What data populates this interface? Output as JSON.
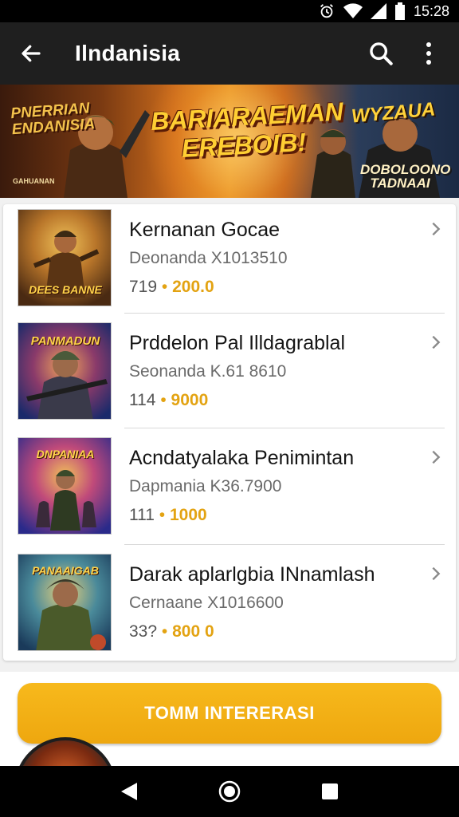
{
  "status_bar": {
    "time": "15:28",
    "icons": [
      "alarm-icon",
      "wifi-icon",
      "signal-icon",
      "battery-icon"
    ]
  },
  "app_bar": {
    "title": "Ilndanisia",
    "icons": [
      "back-arrow-icon",
      "search-icon",
      "overflow-menu-icon"
    ]
  },
  "banner": {
    "left_tag": "PNERRIAN ENDANISIA",
    "title": "BARIARAEMAN EREBOIB!",
    "right_tag": "WYZAUA",
    "right_sub": "DOBOLOONO TADNAAI",
    "corner_tag": "GAHUANAN"
  },
  "items": [
    {
      "title": "Kernanan Gocae",
      "subtitle": "Deonanda X1013510",
      "count": "719",
      "separator": "•",
      "price": "200.0",
      "thumb_label": "DEES BANNE"
    },
    {
      "title": "Prddelon  Pal Illdagrablal",
      "subtitle": "Seonanda K.61 8610",
      "count": "114",
      "separator": "•",
      "price": "9000",
      "thumb_label": "PANMADUN"
    },
    {
      "title": "Acndatyalaka Penimintan",
      "subtitle": "Dapmania K36.7900",
      "count": "111",
      "separator": "•",
      "price": "1000",
      "thumb_label": "DNPANIAA"
    },
    {
      "title": "Darak aplarlgbia INnamlash",
      "subtitle": "Cernaane X1016600",
      "count": "33?",
      "separator": "•",
      "price": "800 0",
      "thumb_label": "PANAAIGAB"
    }
  ],
  "cta": {
    "label": "TOMM INTERERASI"
  },
  "colors": {
    "accent": "#f2ae14",
    "app_bar": "#1f1f1f",
    "price": "#e3a312"
  },
  "nav": {
    "icons": [
      "back-triangle-icon",
      "home-circle-icon",
      "recents-square-icon"
    ]
  }
}
